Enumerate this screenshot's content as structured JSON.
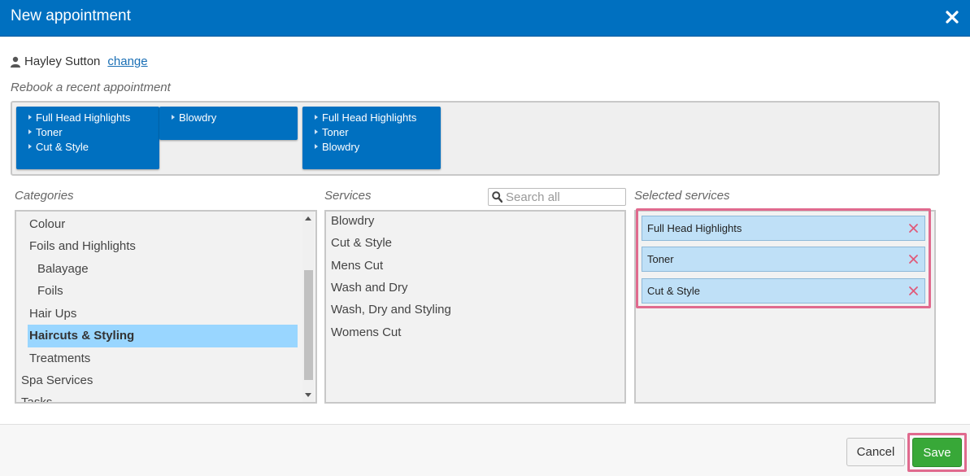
{
  "dialog": {
    "title": "New appointment",
    "close_icon": "close-icon"
  },
  "client": {
    "name": "Hayley Sutton",
    "change_label": "change",
    "icon": "person-icon"
  },
  "rebook": {
    "label": "Rebook a recent appointment",
    "appointments": [
      {
        "services": [
          "Full Head Highlights",
          "Toner",
          "Cut & Style"
        ]
      },
      {
        "services": [
          "Blowdry"
        ]
      },
      {
        "services": [
          "Full Head Highlights",
          "Toner",
          "Blowdry"
        ]
      }
    ]
  },
  "categories": {
    "label": "Categories",
    "items": [
      "Colour",
      "Foils and Highlights",
      "Balayage",
      "Foils",
      "Hair Ups",
      "Haircuts & Styling",
      "Treatments",
      "Spa Services",
      "Tasks"
    ],
    "selected": "Haircuts & Styling"
  },
  "services": {
    "label": "Services",
    "search_placeholder": "Search all",
    "items": [
      "Blowdry",
      "Cut & Style",
      "Mens Cut",
      "Wash and Dry",
      "Wash, Dry and Styling",
      "Womens Cut"
    ]
  },
  "selected_services": {
    "label": "Selected services",
    "items": [
      "Full Head Highlights",
      "Toner",
      "Cut & Style"
    ]
  },
  "footer": {
    "cancel_label": "Cancel",
    "save_label": "Save"
  },
  "colors": {
    "header": "#0070c0",
    "selected_category": "#99d6ff",
    "selected_service": "#bfe0f7",
    "save": "#38a838",
    "remove": "#e05a7a",
    "highlight_border": "#e06a8e"
  }
}
